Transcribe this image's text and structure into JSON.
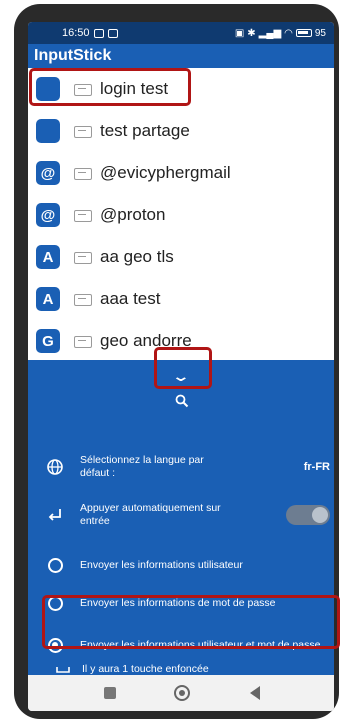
{
  "status_bar": {
    "time": "16:50",
    "battery": "95"
  },
  "app": {
    "title": "InputStick"
  },
  "entries": [
    {
      "badge": "",
      "label": "login test"
    },
    {
      "badge": "",
      "label": "test partage"
    },
    {
      "badge": "@",
      "label": "@evicyphergmail"
    },
    {
      "badge": "@",
      "label": "@proton"
    },
    {
      "badge": "A",
      "label": "aa geo tls"
    },
    {
      "badge": "A",
      "label": "aaa test"
    },
    {
      "badge": "G",
      "label": "geo andorre"
    }
  ],
  "settings": {
    "language_label": "Sélectionnez la langue par défaut :",
    "language_value": "fr-FR",
    "auto_enter_label": "Appuyer automatiquement sur entrée",
    "auto_enter_on": false,
    "options": [
      {
        "label": "Envoyer les informations utilisateur",
        "selected": false
      },
      {
        "label": "Envoyer les informations de mot de passe",
        "selected": false
      },
      {
        "label": "Envoyer les informations utilisateur et mot de passe",
        "selected": true
      }
    ],
    "key_press_info": "Il y aura 1 touche enfoncée"
  },
  "colors": {
    "primary": "#1a5fb4",
    "status_bar": "#0f3a70",
    "highlight": "#b01515"
  }
}
